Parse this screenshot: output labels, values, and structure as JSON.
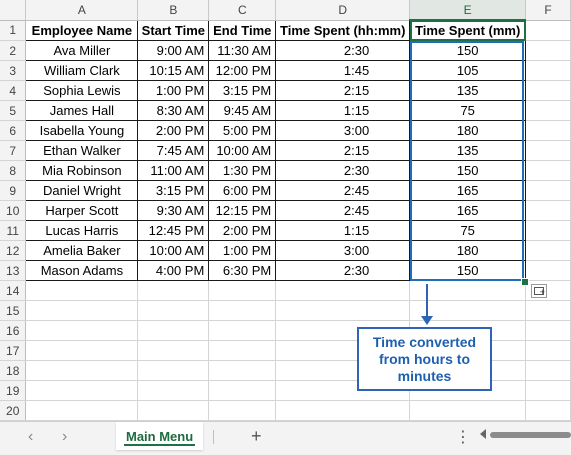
{
  "columns": [
    "",
    "A",
    "B",
    "C",
    "D",
    "E",
    "F"
  ],
  "row_numbers": [
    "1",
    "2",
    "3",
    "4",
    "5",
    "6",
    "7",
    "8",
    "9",
    "10",
    "11",
    "12",
    "13",
    "14",
    "15",
    "16",
    "17",
    "18",
    "19",
    "20"
  ],
  "headers": [
    "Employee Name",
    "Start Time",
    "End Time",
    "Time Spent (hh:mm)",
    "Time Spent (mm)"
  ],
  "rows": [
    [
      "Ava Miller",
      "9:00 AM",
      "11:30 AM",
      "2:30",
      "150"
    ],
    [
      "William Clark",
      "10:15 AM",
      "12:00 PM",
      "1:45",
      "105"
    ],
    [
      "Sophia Lewis",
      "1:00 PM",
      "3:15 PM",
      "2:15",
      "135"
    ],
    [
      "James Hall",
      "8:30 AM",
      "9:45 AM",
      "1:15",
      "75"
    ],
    [
      "Isabella Young",
      "2:00 PM",
      "5:00 PM",
      "3:00",
      "180"
    ],
    [
      "Ethan Walker",
      "7:45 AM",
      "10:00 AM",
      "2:15",
      "135"
    ],
    [
      "Mia Robinson",
      "11:00 AM",
      "1:30 PM",
      "2:30",
      "150"
    ],
    [
      "Daniel Wright",
      "3:15 PM",
      "6:00 PM",
      "2:45",
      "165"
    ],
    [
      "Harper Scott",
      "9:30 AM",
      "12:15 PM",
      "2:45",
      "165"
    ],
    [
      "Lucas Harris",
      "12:45 PM",
      "2:00 PM",
      "1:15",
      "75"
    ],
    [
      "Amelia Baker",
      "10:00 AM",
      "1:00 PM",
      "3:00",
      "180"
    ],
    [
      "Mason Adams",
      "4:00 PM",
      "6:30 PM",
      "2:30",
      "150"
    ]
  ],
  "callout": {
    "text": "Time converted from hours to minutes"
  },
  "sheet_tab": {
    "label": "Main Menu"
  },
  "tabbar": {
    "add_label": "+",
    "more_label": "⋮",
    "prev_label": "‹",
    "next_label": "›"
  },
  "icons": {
    "quick_analysis": "quick-analysis-icon",
    "add_sheet": "plus-icon"
  },
  "colors": {
    "accent_green": "#1e7145",
    "annotation_blue": "#2e64b5"
  }
}
